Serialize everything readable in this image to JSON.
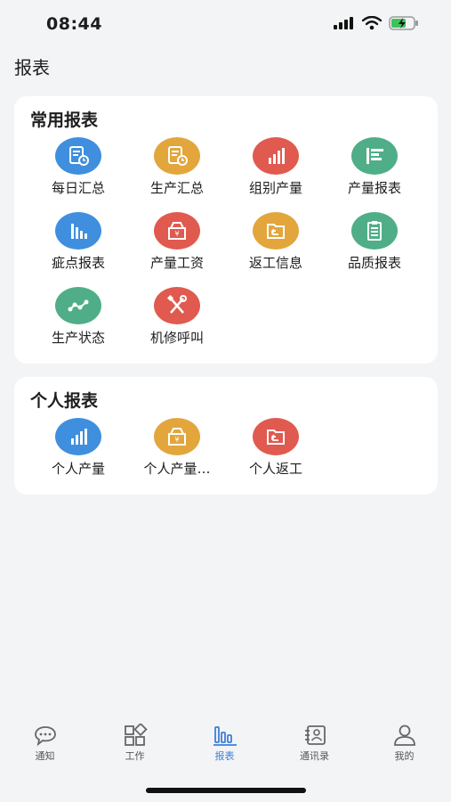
{
  "status_bar": {
    "time": "08:44"
  },
  "page": {
    "title": "报表"
  },
  "common_reports": {
    "title": "常用报表",
    "items": [
      {
        "label": "每日汇总",
        "icon": "daily-summary-icon",
        "color": "#3f8fde"
      },
      {
        "label": "生产汇总",
        "icon": "production-summary-icon",
        "color": "#e2a63d"
      },
      {
        "label": "组别产量",
        "icon": "group-output-icon",
        "color": "#e05a4f"
      },
      {
        "label": "产量报表",
        "icon": "output-report-icon",
        "color": "#4fae88"
      },
      {
        "label": "疵点报表",
        "icon": "defect-report-icon",
        "color": "#3f8fde"
      },
      {
        "label": "产量工资",
        "icon": "output-wage-icon",
        "color": "#e05a4f"
      },
      {
        "label": "返工信息",
        "icon": "rework-info-icon",
        "color": "#e2a63d"
      },
      {
        "label": "品质报表",
        "icon": "quality-report-icon",
        "color": "#4fae88"
      },
      {
        "label": "生产状态",
        "icon": "production-status-icon",
        "color": "#4fae88"
      },
      {
        "label": "机修呼叫",
        "icon": "repair-call-icon",
        "color": "#e05a4f"
      }
    ]
  },
  "personal_reports": {
    "title": "个人报表",
    "items": [
      {
        "label": "个人产量",
        "icon": "personal-output-icon",
        "color": "#3f8fde"
      },
      {
        "label": "个人产量…",
        "icon": "personal-output-wage-icon",
        "color": "#e2a63d"
      },
      {
        "label": "个人返工",
        "icon": "personal-rework-icon",
        "color": "#e05a4f"
      }
    ]
  },
  "tabbar": {
    "active_color": "#3d7fd8",
    "tabs": [
      {
        "label": "通知",
        "icon": "chat-bubble-icon"
      },
      {
        "label": "工作",
        "icon": "apps-grid-icon"
      },
      {
        "label": "报表",
        "icon": "bar-chart-icon",
        "active": true
      },
      {
        "label": "通讯录",
        "icon": "contacts-icon"
      },
      {
        "label": "我的",
        "icon": "person-icon"
      }
    ]
  }
}
